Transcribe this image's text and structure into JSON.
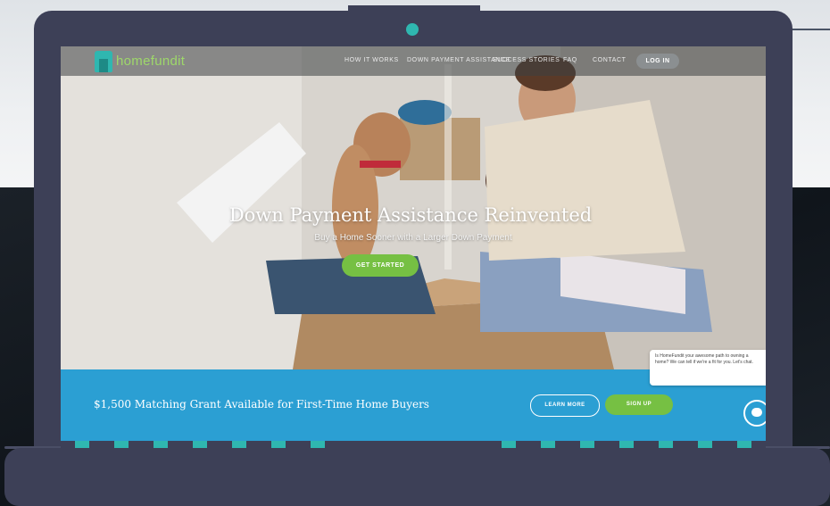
{
  "brand": {
    "logo_text": "homefundit",
    "teal": "#2fb7b0",
    "green": "#76c043",
    "blue": "#2b9fd3",
    "laptop_frame": "#3d4057"
  },
  "nav": {
    "items": [
      "HOW IT WORKS",
      "DOWN PAYMENT ASSISTANCE",
      "SUCCESS STORIES",
      "FAQ",
      "CONTACT"
    ],
    "login_label": "LOG IN"
  },
  "hero": {
    "headline": "Down Payment Assistance Reinvented",
    "subheadline": "Buy a Home Sooner with a Larger Down Payment",
    "cta_label": "GET STARTED"
  },
  "banner": {
    "text": "$1,500 Matching Grant Available for First-Time Home Buyers",
    "learn_more_label": "LEARN MORE",
    "sign_up_label": "SIGN UP"
  },
  "chat": {
    "popup_text": "Is HomeFundit your awesome path to owning a home? We can tell if we're a fit for you. Let's chat.",
    "icon": "chat-bubble-icon"
  }
}
